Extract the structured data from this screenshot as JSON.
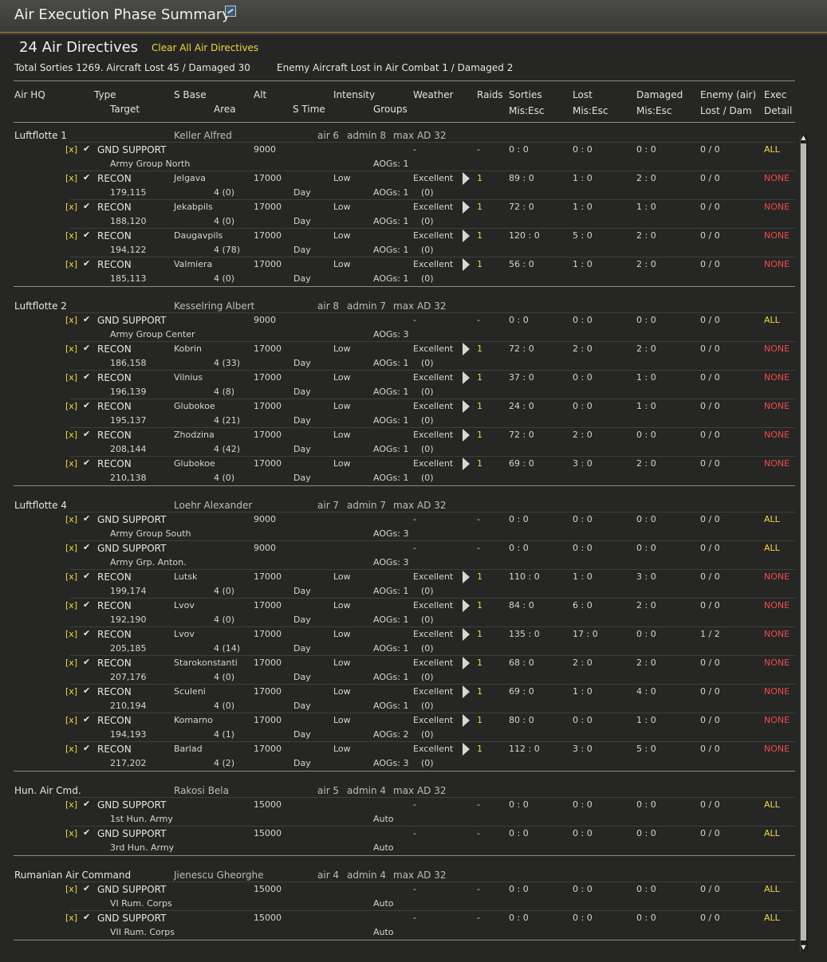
{
  "window": {
    "title": "Air Execution Phase Summary",
    "title_icon": "map-icon"
  },
  "summary": {
    "directives_title": "24 Air Directives",
    "clear_button": "Clear All Air Directives",
    "totals": "Total Sorties 1269. Aircraft Lost 45 / Damaged 30",
    "enemy_totals": "Enemy Aircraft Lost in Air Combat 1 / Damaged 2"
  },
  "headers": {
    "air_hq": "Air HQ",
    "type": "Type",
    "target": "Target",
    "s_base": "S Base",
    "area": "Area",
    "alt": "Alt",
    "s_time": "S Time",
    "intensity": "Intensity",
    "groups": "Groups",
    "weather": "Weather",
    "raids": "Raids",
    "sorties": "Sorties",
    "sorties_sub": "Mis:Esc",
    "lost": "Lost",
    "lost_sub": "Mis:Esc",
    "damaged": "Damaged",
    "damaged_sub": "Mis:Esc",
    "enemy": "Enemy (air)",
    "enemy_sub": "Lost / Dam",
    "exec": "Exec",
    "exec_sub": "Detail"
  },
  "groups": [
    {
      "name": "Luftflotte 1",
      "commander": "Keller Alfred",
      "air": "air 6",
      "admin": "admin 8",
      "max": "max AD 32",
      "rows": [
        {
          "chk": "[x]",
          "type": "GND SUPPORT",
          "base": "",
          "alt": "9000",
          "intensity": "",
          "weather": "-",
          "raids": "-",
          "sorties": "0 : 0",
          "lost": "0 : 0",
          "damaged": "0 : 0",
          "enemy": "0 / 0",
          "exec": "ALL",
          "target": "Army Group North",
          "area": "",
          "stime": "",
          "groups": "AOGs: 1",
          "paren": ""
        },
        {
          "chk": "[x]",
          "type": "RECON",
          "base": "Jelgava",
          "alt": "17000",
          "intensity": "Low",
          "weather": "Excellent",
          "raids": "1",
          "sorties": "89 : 0",
          "lost": "1 : 0",
          "damaged": "2 : 0",
          "enemy": "0 / 0",
          "exec": "NONE",
          "target": "179,115",
          "area": "4 (0)",
          "stime": "Day",
          "groups": "AOGs: 1",
          "paren": "(0)"
        },
        {
          "chk": "[x]",
          "type": "RECON",
          "base": "Jekabpils",
          "alt": "17000",
          "intensity": "Low",
          "weather": "Excellent",
          "raids": "1",
          "sorties": "72 : 0",
          "lost": "1 : 0",
          "damaged": "1 : 0",
          "enemy": "0 / 0",
          "exec": "NONE",
          "target": "188,120",
          "area": "4 (0)",
          "stime": "Day",
          "groups": "AOGs: 1",
          "paren": "(0)"
        },
        {
          "chk": "[x]",
          "type": "RECON",
          "base": "Daugavpils",
          "alt": "17000",
          "intensity": "Low",
          "weather": "Excellent",
          "raids": "1",
          "sorties": "120 : 0",
          "lost": "5 : 0",
          "damaged": "2 : 0",
          "enemy": "0 / 0",
          "exec": "NONE",
          "target": "194,122",
          "area": "4 (78)",
          "stime": "Day",
          "groups": "AOGs: 1",
          "paren": "(0)"
        },
        {
          "chk": "[x]",
          "type": "RECON",
          "base": "Valmiera",
          "alt": "17000",
          "intensity": "Low",
          "weather": "Excellent",
          "raids": "1",
          "sorties": "56 : 0",
          "lost": "1 : 0",
          "damaged": "2 : 0",
          "enemy": "0 / 0",
          "exec": "NONE",
          "target": "185,113",
          "area": "4 (0)",
          "stime": "Day",
          "groups": "AOGs: 1",
          "paren": "(0)"
        }
      ]
    },
    {
      "name": "Luftflotte 2",
      "commander": "Kesselring Albert",
      "air": "air 8",
      "admin": "admin 7",
      "max": "max AD 32",
      "rows": [
        {
          "chk": "[x]",
          "type": "GND SUPPORT",
          "base": "",
          "alt": "9000",
          "intensity": "",
          "weather": "-",
          "raids": "-",
          "sorties": "0 : 0",
          "lost": "0 : 0",
          "damaged": "0 : 0",
          "enemy": "0 / 0",
          "exec": "ALL",
          "target": "Army Group Center",
          "area": "",
          "stime": "",
          "groups": "AOGs: 3",
          "paren": ""
        },
        {
          "chk": "[x]",
          "type": "RECON",
          "base": "Kobrin",
          "alt": "17000",
          "intensity": "Low",
          "weather": "Excellent",
          "raids": "1",
          "sorties": "72 : 0",
          "lost": "2 : 0",
          "damaged": "2 : 0",
          "enemy": "0 / 0",
          "exec": "NONE",
          "target": "186,158",
          "area": "4 (33)",
          "stime": "Day",
          "groups": "AOGs: 1",
          "paren": "(0)"
        },
        {
          "chk": "[x]",
          "type": "RECON",
          "base": "Vilnius",
          "alt": "17000",
          "intensity": "Low",
          "weather": "Excellent",
          "raids": "1",
          "sorties": "37 : 0",
          "lost": "0 : 0",
          "damaged": "1 : 0",
          "enemy": "0 / 0",
          "exec": "NONE",
          "target": "196,139",
          "area": "4 (8)",
          "stime": "Day",
          "groups": "AOGs: 1",
          "paren": "(0)"
        },
        {
          "chk": "[x]",
          "type": "RECON",
          "base": "Glubokoe",
          "alt": "17000",
          "intensity": "Low",
          "weather": "Excellent",
          "raids": "1",
          "sorties": "24 : 0",
          "lost": "0 : 0",
          "damaged": "1 : 0",
          "enemy": "0 / 0",
          "exec": "NONE",
          "target": "195,137",
          "area": "4 (21)",
          "stime": "Day",
          "groups": "AOGs: 1",
          "paren": "(0)"
        },
        {
          "chk": "[x]",
          "type": "RECON",
          "base": "Zhodzina",
          "alt": "17000",
          "intensity": "Low",
          "weather": "Excellent",
          "raids": "1",
          "sorties": "72 : 0",
          "lost": "2 : 0",
          "damaged": "0 : 0",
          "enemy": "0 / 0",
          "exec": "NONE",
          "target": "208,144",
          "area": "4 (42)",
          "stime": "Day",
          "groups": "AOGs: 1",
          "paren": "(0)"
        },
        {
          "chk": "[x]",
          "type": "RECON",
          "base": "Glubokoe",
          "alt": "17000",
          "intensity": "Low",
          "weather": "Excellent",
          "raids": "1",
          "sorties": "69 : 0",
          "lost": "3 : 0",
          "damaged": "2 : 0",
          "enemy": "0 / 0",
          "exec": "NONE",
          "target": "210,138",
          "area": "4 (0)",
          "stime": "Day",
          "groups": "AOGs: 1",
          "paren": "(0)"
        }
      ]
    },
    {
      "name": "Luftflotte 4",
      "commander": "Loehr Alexander",
      "air": "air 7",
      "admin": "admin 7",
      "max": "max AD 32",
      "rows": [
        {
          "chk": "[x]",
          "type": "GND SUPPORT",
          "base": "",
          "alt": "9000",
          "intensity": "",
          "weather": "-",
          "raids": "-",
          "sorties": "0 : 0",
          "lost": "0 : 0",
          "damaged": "0 : 0",
          "enemy": "0 / 0",
          "exec": "ALL",
          "target": "Army Group South",
          "area": "",
          "stime": "",
          "groups": "AOGs: 3",
          "paren": ""
        },
        {
          "chk": "[x]",
          "type": "GND SUPPORT",
          "base": "",
          "alt": "9000",
          "intensity": "",
          "weather": "-",
          "raids": "-",
          "sorties": "0 : 0",
          "lost": "0 : 0",
          "damaged": "0 : 0",
          "enemy": "0 / 0",
          "exec": "ALL",
          "target": "Army Grp. Anton.",
          "area": "",
          "stime": "",
          "groups": "AOGs: 3",
          "paren": ""
        },
        {
          "chk": "[x]",
          "type": "RECON",
          "base": "Lutsk",
          "alt": "17000",
          "intensity": "Low",
          "weather": "Excellent",
          "raids": "1",
          "sorties": "110 : 0",
          "lost": "1 : 0",
          "damaged": "3 : 0",
          "enemy": "0 / 0",
          "exec": "NONE",
          "target": "199,174",
          "area": "4 (0)",
          "stime": "Day",
          "groups": "AOGs: 1",
          "paren": "(0)"
        },
        {
          "chk": "[x]",
          "type": "RECON",
          "base": "Lvov",
          "alt": "17000",
          "intensity": "Low",
          "weather": "Excellent",
          "raids": "1",
          "sorties": "84 : 0",
          "lost": "6 : 0",
          "damaged": "2 : 0",
          "enemy": "0 / 0",
          "exec": "NONE",
          "target": "192,190",
          "area": "4 (0)",
          "stime": "Day",
          "groups": "AOGs: 1",
          "paren": "(0)"
        },
        {
          "chk": "[x]",
          "type": "RECON",
          "base": "Lvov",
          "alt": "17000",
          "intensity": "Low",
          "weather": "Excellent",
          "raids": "1",
          "sorties": "135 : 0",
          "lost": "17 : 0",
          "damaged": "0 : 0",
          "enemy": "1 / 2",
          "exec": "NONE",
          "target": "205,185",
          "area": "4 (14)",
          "stime": "Day",
          "groups": "AOGs: 1",
          "paren": "(0)"
        },
        {
          "chk": "[x]",
          "type": "RECON",
          "base": "Starokonstanti",
          "alt": "17000",
          "intensity": "Low",
          "weather": "Excellent",
          "raids": "1",
          "sorties": "68 : 0",
          "lost": "2 : 0",
          "damaged": "2 : 0",
          "enemy": "0 / 0",
          "exec": "NONE",
          "target": "207,176",
          "area": "4 (0)",
          "stime": "Day",
          "groups": "AOGs: 1",
          "paren": "(0)"
        },
        {
          "chk": "[x]",
          "type": "RECON",
          "base": "Sculeni",
          "alt": "17000",
          "intensity": "Low",
          "weather": "Excellent",
          "raids": "1",
          "sorties": "69 : 0",
          "lost": "1 : 0",
          "damaged": "4 : 0",
          "enemy": "0 / 0",
          "exec": "NONE",
          "target": "210,194",
          "area": "4 (0)",
          "stime": "Day",
          "groups": "AOGs: 1",
          "paren": "(0)"
        },
        {
          "chk": "[x]",
          "type": "RECON",
          "base": "Komarno",
          "alt": "17000",
          "intensity": "Low",
          "weather": "Excellent",
          "raids": "1",
          "sorties": "80 : 0",
          "lost": "0 : 0",
          "damaged": "1 : 0",
          "enemy": "0 / 0",
          "exec": "NONE",
          "target": "194,193",
          "area": "4 (1)",
          "stime": "Day",
          "groups": "AOGs: 2",
          "paren": "(0)"
        },
        {
          "chk": "[x]",
          "type": "RECON",
          "base": "Barlad",
          "alt": "17000",
          "intensity": "Low",
          "weather": "Excellent",
          "raids": "1",
          "sorties": "112 : 0",
          "lost": "3 : 0",
          "damaged": "5 : 0",
          "enemy": "0 / 0",
          "exec": "NONE",
          "target": "217,202",
          "area": "4 (2)",
          "stime": "Day",
          "groups": "AOGs: 3",
          "paren": "(0)"
        }
      ]
    },
    {
      "name": "Hun. Air Cmd.",
      "commander": "Rakosi Bela",
      "air": "air 5",
      "admin": "admin 4",
      "max": "max AD 32",
      "rows": [
        {
          "chk": "[x]",
          "type": "GND SUPPORT",
          "base": "",
          "alt": "15000",
          "intensity": "",
          "weather": "-",
          "raids": "-",
          "sorties": "0 : 0",
          "lost": "0 : 0",
          "damaged": "0 : 0",
          "enemy": "0 / 0",
          "exec": "ALL",
          "target": "1st Hun. Army",
          "area": "",
          "stime": "",
          "groups": "Auto",
          "paren": ""
        },
        {
          "chk": "[x]",
          "type": "GND SUPPORT",
          "base": "",
          "alt": "15000",
          "intensity": "",
          "weather": "-",
          "raids": "-",
          "sorties": "0 : 0",
          "lost": "0 : 0",
          "damaged": "0 : 0",
          "enemy": "0 / 0",
          "exec": "ALL",
          "target": "3rd Hun. Army",
          "area": "",
          "stime": "",
          "groups": "Auto",
          "paren": ""
        }
      ]
    },
    {
      "name": "Rumanian Air Command",
      "commander": "Jienescu Gheorghe",
      "air": "air 4",
      "admin": "admin 4",
      "max": "max AD 32",
      "rows": [
        {
          "chk": "[x]",
          "type": "GND SUPPORT",
          "base": "",
          "alt": "15000",
          "intensity": "",
          "weather": "-",
          "raids": "-",
          "sorties": "0 : 0",
          "lost": "0 : 0",
          "damaged": "0 : 0",
          "enemy": "0 / 0",
          "exec": "ALL",
          "target": "VI Rum. Corps",
          "area": "",
          "stime": "",
          "groups": "Auto",
          "paren": ""
        },
        {
          "chk": "[x]",
          "type": "GND SUPPORT",
          "base": "",
          "alt": "15000",
          "intensity": "",
          "weather": "-",
          "raids": "-",
          "sorties": "0 : 0",
          "lost": "0 : 0",
          "damaged": "0 : 0",
          "enemy": "0 / 0",
          "exec": "ALL",
          "target": "VII Rum. Corps",
          "area": "",
          "stime": "",
          "groups": "Auto",
          "paren": ""
        }
      ]
    }
  ],
  "colors": {
    "accent": "#f0d840",
    "none": "#ef4b4b",
    "background": "#262625"
  }
}
